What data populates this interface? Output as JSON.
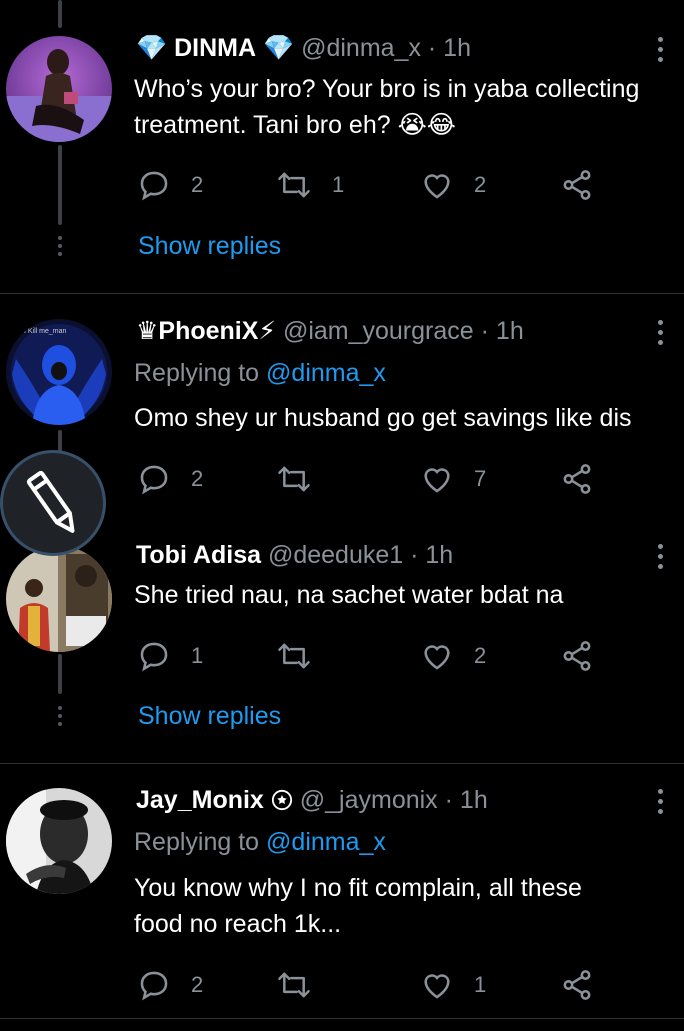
{
  "tweets": [
    {
      "name": "DINMA",
      "name_emoji_left": "💎",
      "name_emoji_right": "💎",
      "handle": "@dinma_x",
      "time": "· 1h",
      "text_line1": "Who’s your bro? Your bro is in yaba collecting",
      "text_line2": "treatment. Tani bro eh? 😭😂",
      "replies": "2",
      "retweets": "1",
      "likes": "2",
      "show_replies": "Show replies"
    },
    {
      "name": "♛PhoeniX⚡",
      "handle": "@iam_yourgrace",
      "time": "· 1h",
      "replying_prefix": "Replying to",
      "replying_handle": "@dinma_x",
      "text_line1": "Omo shey ur husband go get savings like dis",
      "replies": "2",
      "retweets": "",
      "likes": "7"
    },
    {
      "name": "Tobi Adisa",
      "handle": "@deeduke1",
      "time": "· 1h",
      "text_line1": "She tried nau, na sachet water bdat na",
      "replies": "1",
      "retweets": "",
      "likes": "2",
      "show_replies": "Show replies"
    },
    {
      "name": "Jay_Monix",
      "handle": "@_jaymonix",
      "time": "· 1h",
      "replying_prefix": "Replying to",
      "replying_handle": "@dinma_x",
      "text_line1": "You know why I no fit complain, all these",
      "text_line2": "food no reach 1k...",
      "replies": "2",
      "retweets": "",
      "likes": "1"
    }
  ],
  "colors": {
    "background": "#000000",
    "link": "#1d9bf0",
    "muted": "#8b9198",
    "divider": "#2f3336"
  },
  "icons": [
    "reply-icon",
    "retweet-icon",
    "like-icon",
    "share-icon",
    "more-icon",
    "compose-icon",
    "diamond-emoji",
    "verified-badge-icon"
  ]
}
